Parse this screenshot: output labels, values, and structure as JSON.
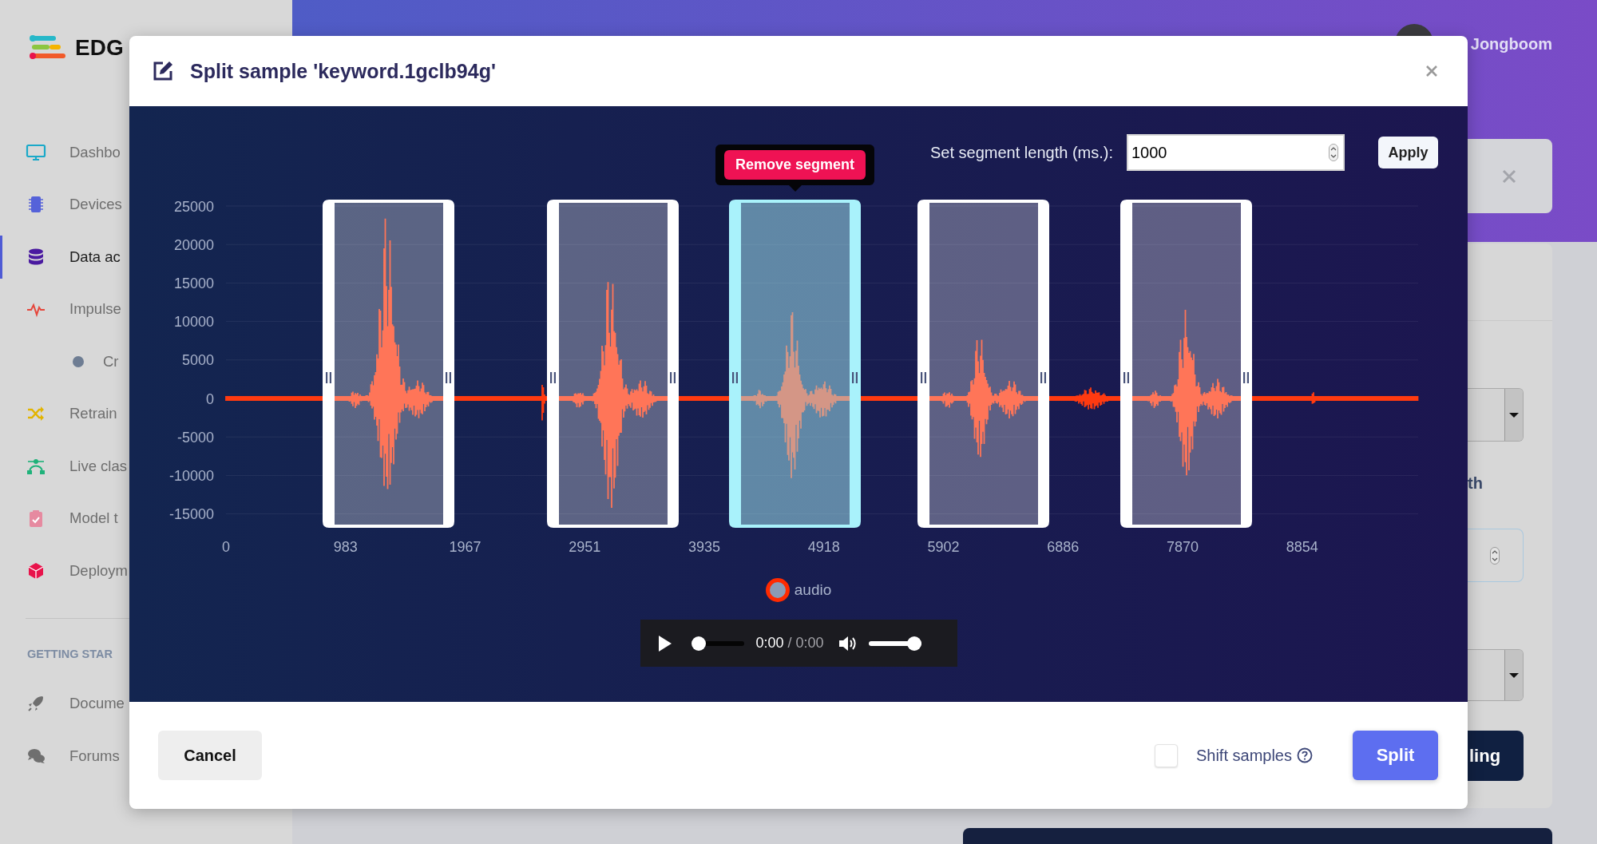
{
  "sidebar": {
    "logo_text": "EDG",
    "items": [
      {
        "kind": "monitor",
        "label": "Dashbo",
        "selected": false
      },
      {
        "kind": "chip",
        "label": "Devices",
        "selected": false
      },
      {
        "kind": "database",
        "label": "Data ac",
        "selected": true
      },
      {
        "kind": "pulse",
        "label": "Impulse",
        "selected": false,
        "children": [
          {
            "kind": "dot",
            "label": "Cr",
            "selected": false
          }
        ]
      },
      {
        "kind": "shuffle",
        "label": "Retrain",
        "selected": false
      },
      {
        "kind": "network",
        "label": "Live clas",
        "selected": false
      },
      {
        "kind": "clipboard",
        "label": "Model t",
        "selected": false
      },
      {
        "kind": "cube",
        "label": "Deploym",
        "selected": false
      }
    ],
    "section_title": "GETTING STAR",
    "help_items": [
      {
        "kind": "rocket",
        "label": "Docume"
      },
      {
        "kind": "chat",
        "label": "Forums"
      }
    ]
  },
  "header": {
    "user_name": "Jongboom"
  },
  "background_panel": {
    "label": "th",
    "button": "ling"
  },
  "modal": {
    "title": "Split sample 'keyword.1gclb94g'",
    "segment_length": {
      "label": "Set segment length (ms.):",
      "value": "1000"
    },
    "apply_button": "Apply",
    "chart": {
      "y_ticks": [
        "25000",
        "20000",
        "15000",
        "10000",
        "5000",
        "0",
        "-5000",
        "-10000",
        "-15000"
      ],
      "x_ticks": [
        "0",
        "983",
        "1967",
        "2951",
        "3935",
        "4918",
        "5902",
        "6886",
        "7870",
        "8854"
      ],
      "segments": [
        {
          "selected": false
        },
        {
          "selected": false
        },
        {
          "selected": true
        },
        {
          "selected": false
        },
        {
          "selected": false
        }
      ],
      "tooltip_button": "Remove segment",
      "legend": "audio"
    },
    "player": {
      "current_time": "0:00",
      "duration": "/ 0:00",
      "seek": {
        "level": 0
      },
      "volume": {
        "level": 1
      }
    },
    "cancel_button": "Cancel",
    "shift_samples": {
      "label": "Shift samples",
      "checked": false
    },
    "split_button": "Split"
  }
}
